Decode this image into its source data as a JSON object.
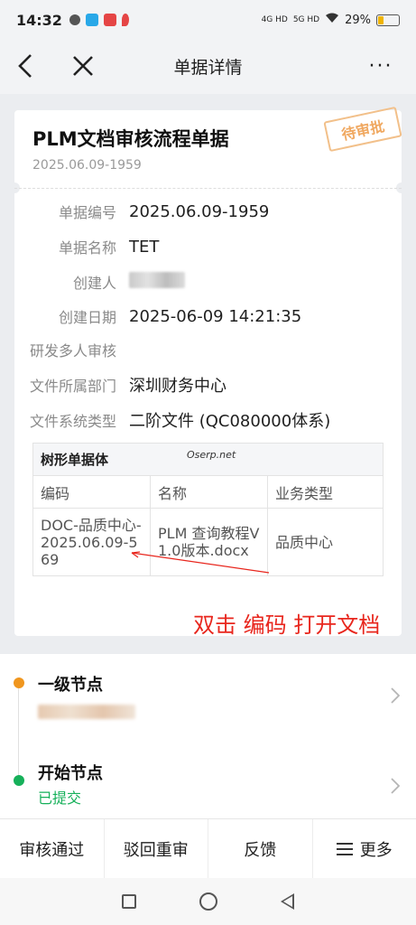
{
  "status_bar": {
    "time": "14:32",
    "signal_1": "4G HD",
    "signal_2": "5G HD",
    "battery": "29%",
    "battery_level": 0.29,
    "battery_color": "#f0b400"
  },
  "nav": {
    "back_icon": "chevron-left-icon",
    "close_icon": "close-icon",
    "title": "单据详情",
    "more_label": "···"
  },
  "doc": {
    "title": "PLM文档审核流程单据",
    "subtitle": "2025.06.09-1959",
    "stamp": "待审批",
    "fields": [
      {
        "label": "单据编号",
        "value": "2025.06.09-1959"
      },
      {
        "label": "单据名称",
        "value": "TET"
      },
      {
        "label": "创建人",
        "value": ""
      },
      {
        "label": "创建日期",
        "value": "2025-06-09 14:21:35"
      },
      {
        "label": "研发多人审核",
        "value": ""
      },
      {
        "label": "文件所属部门",
        "value": "深圳财务中心"
      },
      {
        "label": "文件系统类型",
        "value": "二阶文件 (QC080000体系)"
      }
    ],
    "table": {
      "title": "树形单据体",
      "watermark": "Oserp.net",
      "columns": [
        "编码",
        "名称",
        "业务类型"
      ],
      "rows": [
        [
          "DOC-品质中心-2025.06.09-569",
          "PLM 查询教程V1.0版本.docx",
          "品质中心"
        ]
      ]
    },
    "annotation": "双击 编码 打开文档",
    "annotation_color": "#e8261d"
  },
  "process": {
    "nodes": [
      {
        "title": "一级节点",
        "status": "",
        "dot_color": "#f0961e"
      },
      {
        "title": "开始节点",
        "status": "已提交",
        "dot_color": "#16b05a"
      }
    ]
  },
  "actions": {
    "approve": "审核通过",
    "reject": "驳回重审",
    "feedback": "反馈",
    "more": "更多"
  }
}
